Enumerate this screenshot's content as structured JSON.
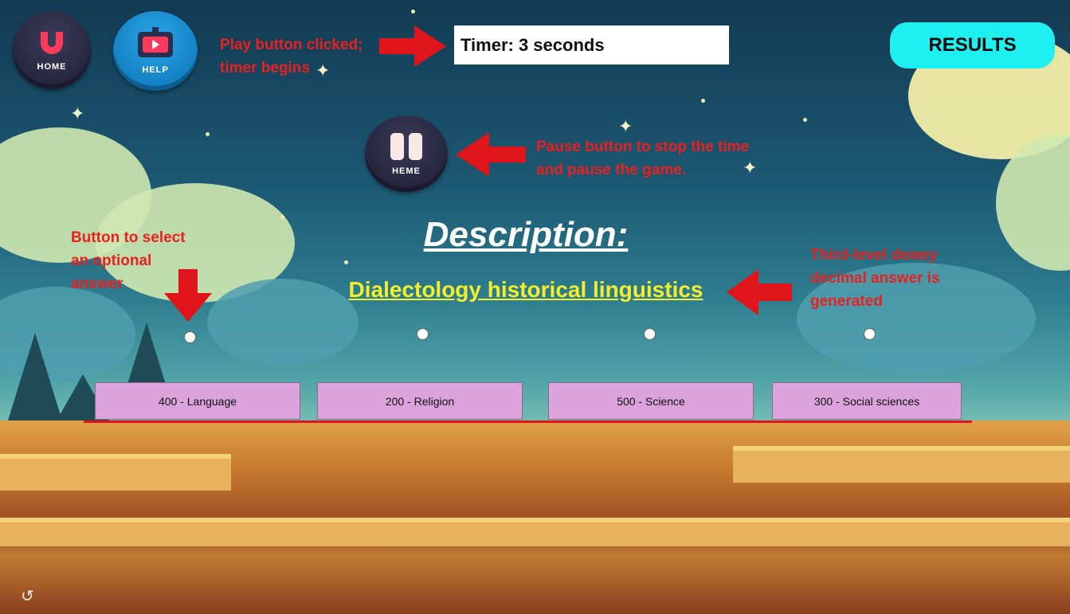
{
  "toolbar": {
    "home_caption": "HOME",
    "help_caption": "HELP",
    "pause_caption": "HEME",
    "results_label": "RESULTS"
  },
  "timer": {
    "text": "Timer: 3 seconds"
  },
  "description": {
    "title": "Description:",
    "answer": "Dialectology  historical linguistics"
  },
  "options": [
    {
      "label": "400 - Language"
    },
    {
      "label": "200 - Religion"
    },
    {
      "label": "500 - Science"
    },
    {
      "label": "300 - Social sciences"
    }
  ],
  "annotations": {
    "play_note": "Play button clicked; timer begins",
    "pause_note": "Pause button to stop the time and pause the game.",
    "select_note": "Button to select an optional answer",
    "answer_note": "Third-level dewey decimal answer is generated"
  },
  "colors": {
    "timer_bg": "#ffffff",
    "results_bg": "#1ef0f2",
    "option_bg": "#dca2dc",
    "answer_text": "#f5ee2a",
    "annotation": "#e8201f"
  },
  "icons": [
    "home-u-icon",
    "help-video-icon",
    "pause-icon",
    "corner-logo-icon",
    "red-arrow-icon"
  ]
}
